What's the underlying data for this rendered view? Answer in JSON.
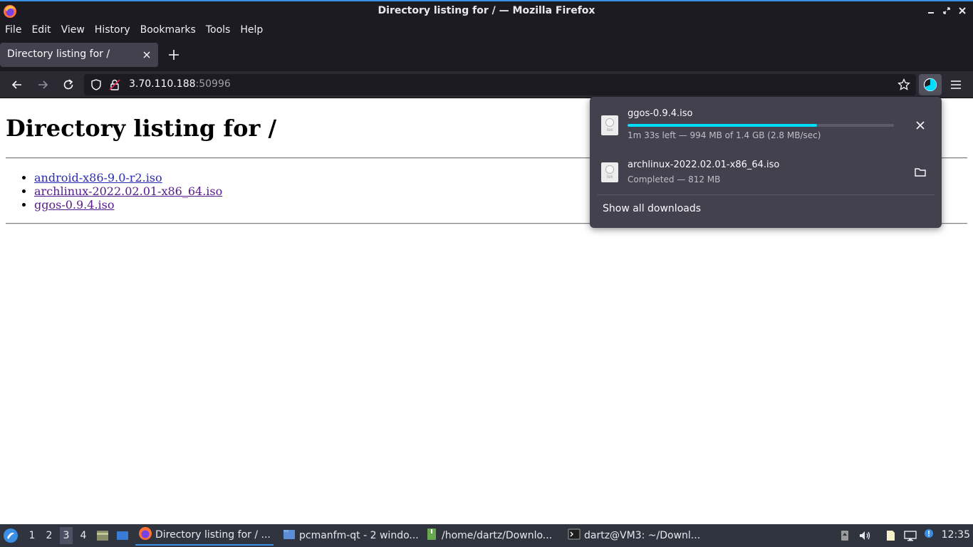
{
  "window": {
    "title": "Directory listing for / — Mozilla Firefox"
  },
  "menubar": {
    "items": [
      {
        "label": "File"
      },
      {
        "label": "Edit"
      },
      {
        "label": "View"
      },
      {
        "label": "History"
      },
      {
        "label": "Bookmarks"
      },
      {
        "label": "Tools"
      },
      {
        "label": "Help"
      }
    ]
  },
  "tabs": [
    {
      "label": "Directory listing for /",
      "active": true
    }
  ],
  "navbar": {
    "url_host": "3.70.110.188",
    "url_port": ":50996"
  },
  "page": {
    "heading": "Directory listing for /",
    "links": [
      {
        "text": "android-x86-9.0-r2.iso",
        "visited": false
      },
      {
        "text": "archlinux-2022.02.01-x86_64.iso",
        "visited": true
      },
      {
        "text": "ggos-0.9.4.iso",
        "visited": true
      }
    ]
  },
  "downloads": {
    "items": [
      {
        "name": "ggos-0.9.4.iso",
        "status": "1m 33s left — 994 MB of 1.4 GB (2.8 MB/sec)",
        "progress": 0.71,
        "in_progress": true,
        "icon_label": "iso"
      },
      {
        "name": "archlinux-2022.02.01-x86_64.iso",
        "status": "Completed — 812 MB",
        "in_progress": false,
        "icon_label": "iso"
      }
    ],
    "show_all_label": "Show all downloads"
  },
  "taskbar": {
    "workspaces": [
      "1",
      "2",
      "3",
      "4"
    ],
    "active_workspace": "3",
    "tasks": [
      {
        "label": "Directory listing for / ...",
        "icon": "firefox-icon",
        "active": true
      },
      {
        "label": "pcmanfm-qt - 2 windo...",
        "icon": "folder-icon",
        "active": false
      },
      {
        "label": "/home/dartz/Downlo...",
        "icon": "archive-icon",
        "active": false
      },
      {
        "label": "dartz@VM3: ~/Downl...",
        "icon": "terminal-icon",
        "active": false
      }
    ],
    "clock": "12:35"
  },
  "colors": {
    "accent": "#3a8ee6",
    "progress": "#00ddff",
    "chrome_dark": "#1c1b22",
    "panel": "#42414d"
  }
}
